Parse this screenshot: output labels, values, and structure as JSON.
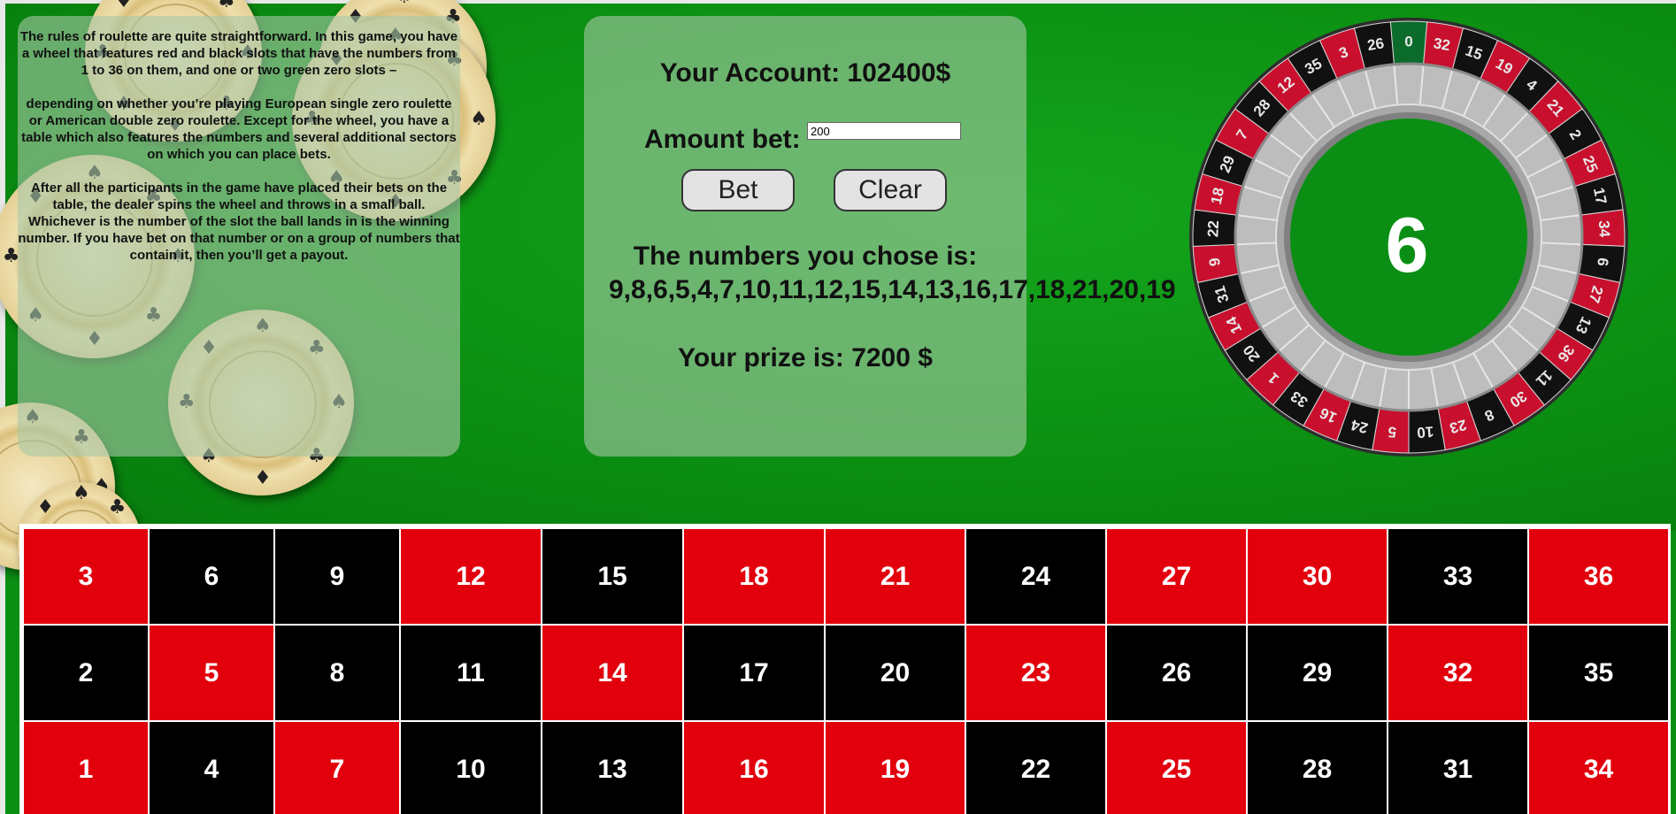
{
  "rules": {
    "paragraphs": [
      "The rules of roulette are quite straightforward. In this game, you have a wheel that features red and black slots that have the numbers from 1 to 36 on them, and one or two green zero slots –",
      "depending on whether you’re playing European single zero roulette or American double zero roulette. Except for the wheel, you have a table which also features the numbers and several additional sectors on which you can place bets.",
      "After all the participants in the game have placed their bets on the table, the dealer spins the wheel and throws in a small ball. Whichever is the number of the slot the ball lands in is the winning number. If you have bet on that number or on a group of numbers that contain it, then you’ll get a payout."
    ]
  },
  "account": {
    "text": "Your Account: 102400$"
  },
  "bet": {
    "label": "Amount bet:",
    "value": "200"
  },
  "buttons": {
    "bet": "Bet",
    "clear": "Clear"
  },
  "chosen": {
    "label": "The numbers you chose is:",
    "values": "9,8,6,5,4,7,10,11,12,15,14,13,16,17,18,21,20,19"
  },
  "prize": {
    "text": "Your prize is: 7200 $"
  },
  "wheel": {
    "result": "6",
    "colors": {
      "red": "#c8102e",
      "black": "#111111",
      "green": "#0b6b2a"
    },
    "slots": [
      "0",
      "32",
      "15",
      "19",
      "4",
      "21",
      "2",
      "25",
      "17",
      "34",
      "6",
      "27",
      "13",
      "36",
      "11",
      "30",
      "8",
      "23",
      "10",
      "5",
      "24",
      "16",
      "33",
      "1",
      "20",
      "14",
      "31",
      "9",
      "22",
      "18",
      "29",
      "7",
      "28",
      "12",
      "35",
      "3",
      "26"
    ]
  },
  "board": {
    "colors": {
      "red": "#e2000d",
      "black": "#000000"
    },
    "rows": [
      [
        {
          "n": "3",
          "c": "red"
        },
        {
          "n": "6",
          "c": "black"
        },
        {
          "n": "9",
          "c": "black"
        },
        {
          "n": "12",
          "c": "red"
        },
        {
          "n": "15",
          "c": "black"
        },
        {
          "n": "18",
          "c": "red"
        },
        {
          "n": "21",
          "c": "red"
        },
        {
          "n": "24",
          "c": "black"
        },
        {
          "n": "27",
          "c": "red"
        },
        {
          "n": "30",
          "c": "red"
        },
        {
          "n": "33",
          "c": "black"
        },
        {
          "n": "36",
          "c": "red"
        }
      ],
      [
        {
          "n": "2",
          "c": "black"
        },
        {
          "n": "5",
          "c": "red"
        },
        {
          "n": "8",
          "c": "black"
        },
        {
          "n": "11",
          "c": "black"
        },
        {
          "n": "14",
          "c": "red"
        },
        {
          "n": "17",
          "c": "black"
        },
        {
          "n": "20",
          "c": "black"
        },
        {
          "n": "23",
          "c": "red"
        },
        {
          "n": "26",
          "c": "black"
        },
        {
          "n": "29",
          "c": "black"
        },
        {
          "n": "32",
          "c": "red"
        },
        {
          "n": "35",
          "c": "black"
        }
      ],
      [
        {
          "n": "1",
          "c": "red"
        },
        {
          "n": "4",
          "c": "black"
        },
        {
          "n": "7",
          "c": "red"
        },
        {
          "n": "10",
          "c": "black"
        },
        {
          "n": "13",
          "c": "black"
        },
        {
          "n": "16",
          "c": "red"
        },
        {
          "n": "19",
          "c": "red"
        },
        {
          "n": "22",
          "c": "black"
        },
        {
          "n": "25",
          "c": "red"
        },
        {
          "n": "28",
          "c": "black"
        },
        {
          "n": "31",
          "c": "black"
        },
        {
          "n": "34",
          "c": "red"
        }
      ]
    ]
  },
  "chips": {
    "pip_symbols": [
      "♠",
      "♣",
      "♦",
      "♠",
      "♣",
      "♦"
    ]
  }
}
